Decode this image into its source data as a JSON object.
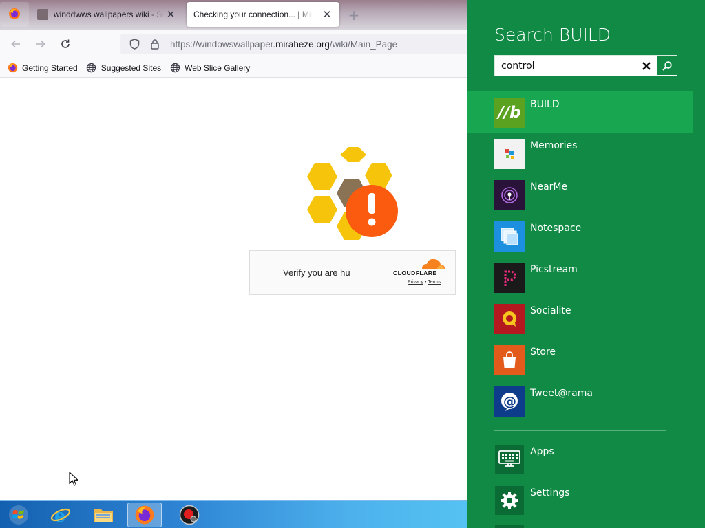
{
  "browser": {
    "tabs": [
      {
        "label": "winddwws wallpapers wiki - Sea",
        "active": false
      },
      {
        "label": "Checking your connection... | Mirah",
        "active": true
      }
    ],
    "url_prefix": "https://windowswallpaper.",
    "url_domain": "miraheze.org",
    "url_suffix": "/wiki/Main_Page",
    "bookmarks": [
      {
        "label": "Getting Started",
        "icon": "firefox-icon"
      },
      {
        "label": "Suggested Sites",
        "icon": "globe-icon"
      },
      {
        "label": "Web Slice Gallery",
        "icon": "globe-icon"
      }
    ]
  },
  "page": {
    "verify_text": "Verify you are hu",
    "cf_brand": "CLOUDFLARE",
    "cf_privacy": "Privacy",
    "cf_separator": "•",
    "cf_terms": "Terms"
  },
  "charm": {
    "title": "Search BUILD",
    "query": "control",
    "results": [
      {
        "label": "BUILD",
        "icon": "build-icon",
        "tile_color": "#5aa21f",
        "selected": true
      },
      {
        "label": "Memories",
        "icon": "memories-icon",
        "tile_color": "#f2f2f2"
      },
      {
        "label": "NearMe",
        "icon": "nearme-icon",
        "tile_color": "#2a1338"
      },
      {
        "label": "Notespace",
        "icon": "notespace-icon",
        "tile_color": "#1c8fde"
      },
      {
        "label": "Picstream",
        "icon": "picstream-icon",
        "tile_color": "#1a1a1a"
      },
      {
        "label": "Socialite",
        "icon": "socialite-icon",
        "tile_color": "#b3191f"
      },
      {
        "label": "Store",
        "icon": "store-icon",
        "tile_color": "#e25b1b"
      },
      {
        "label": "Tweet@rama",
        "icon": "tweetarama-icon",
        "tile_color": "#0d3d8a"
      }
    ],
    "categories": [
      {
        "label": "Apps",
        "icon": "keyboard-icon"
      },
      {
        "label": "Settings",
        "icon": "gear-icon"
      }
    ]
  },
  "taskbar": {
    "items": [
      {
        "name": "start-button",
        "icon": "windows-logo-icon"
      },
      {
        "name": "internet-explorer-button",
        "icon": "internet-explorer-icon"
      },
      {
        "name": "file-explorer-button",
        "icon": "folder-icon"
      },
      {
        "name": "firefox-button",
        "icon": "firefox-icon",
        "active": true
      },
      {
        "name": "recorder-button",
        "icon": "record-icon"
      }
    ]
  },
  "colors": {
    "charm_background": "#118a45",
    "selected_result": "#18a651",
    "cloudflare_orange": "#f6821f",
    "honeycomb_yellow": "#f6c40b",
    "alert_orange": "#fa5b0f"
  }
}
